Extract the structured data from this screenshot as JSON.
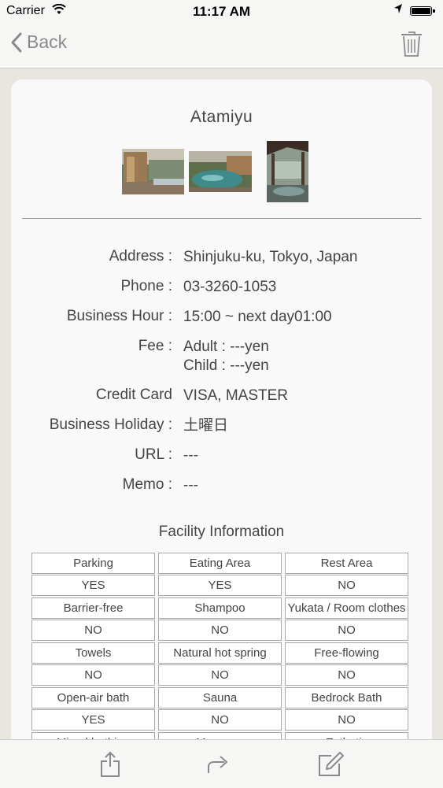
{
  "status_bar": {
    "carrier": "Carrier",
    "time": "11:17 AM"
  },
  "nav": {
    "back_label": "Back"
  },
  "detail": {
    "title": "Atamiyu",
    "fields": [
      {
        "label": "Address :",
        "value": "Shinjuku-ku, Tokyo, Japan"
      },
      {
        "label": "Phone :",
        "value": "03-3260-1053"
      },
      {
        "label": "Business Hour :",
        "value": "15:00 ~ next day01:00"
      },
      {
        "label": "Fee :",
        "value": "Adult : ---yen",
        "value2": "Child : ---yen"
      },
      {
        "label": "Credit Card",
        "value": "VISA, MASTER"
      },
      {
        "label": "Business Holiday :",
        "value": "土曜日"
      },
      {
        "label": "URL :",
        "value": "---"
      },
      {
        "label": "Memo :",
        "value": "---"
      }
    ]
  },
  "facility": {
    "title": "Facility Information",
    "rows": [
      {
        "names": [
          "Parking",
          "Eating Area",
          "Rest Area"
        ],
        "values": [
          "YES",
          "YES",
          "NO"
        ]
      },
      {
        "names": [
          "Barrier-free",
          "Shampoo",
          "Yukata / Room clothes"
        ],
        "values": [
          "NO",
          "NO",
          "NO"
        ]
      },
      {
        "names": [
          "Towels",
          "Natural hot spring",
          "Free-flowing"
        ],
        "values": [
          "NO",
          "NO",
          "NO"
        ]
      },
      {
        "names": [
          "Open-air bath",
          "Sauna",
          "Bedrock Bath"
        ],
        "values": [
          "YES",
          "NO",
          "NO"
        ]
      },
      {
        "names": [
          "Mixed bathing",
          "Massage",
          "Esthetic"
        ],
        "values": [
          "",
          "",
          ""
        ]
      }
    ]
  },
  "toolbar": {
    "icons": [
      "share-icon",
      "forward-icon",
      "edit-icon"
    ]
  },
  "colors": {
    "background": "#e8e6df",
    "card": "#f9f9f9",
    "text": "#444444",
    "nav_tint": "#8a8a8a"
  }
}
